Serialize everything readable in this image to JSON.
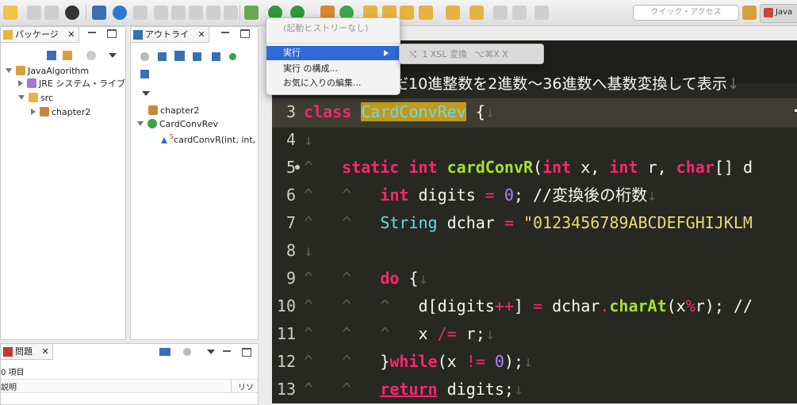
{
  "toolbar": {
    "quick_access_placeholder": "クイック・アクセス",
    "perspective_label": "Java"
  },
  "package_view": {
    "tab_label": "パッケージ",
    "tree": [
      {
        "label": "JavaAlgorithm",
        "expanded": true
      },
      {
        "label": "JRE システム・ライブ",
        "expanded": false
      },
      {
        "label": "src",
        "expanded": true
      },
      {
        "label": "chapter2",
        "expanded": false
      }
    ]
  },
  "outline_view": {
    "tab_label": "アウトライ",
    "tree": [
      {
        "label": "chapter2"
      },
      {
        "label": "CardConvRev"
      },
      {
        "label": "cardConvR(int, int,",
        "modifier": "S"
      }
    ]
  },
  "problems_view": {
    "tab_label": "問題",
    "count_label": "0 項目",
    "columns": [
      "説明",
      "リソ"
    ]
  },
  "run_menu": {
    "items": [
      {
        "label": "(起動ヒストリーなし)",
        "state": "disabled"
      },
      {
        "label": "実行",
        "state": "selected",
        "submenu": true
      },
      {
        "label": "実行 の構成...",
        "state": "normal"
      },
      {
        "label": "お気に入りの編集...",
        "state": "normal"
      }
    ]
  },
  "run_submenu": {
    "items": [
      {
        "label": "1 XSL 変換",
        "shortcut": "⌥⌘X X"
      }
    ]
  },
  "editor": {
    "comment_line_text": "だ10進整数を2進数〜36進数へ基数変換して表示",
    "comment_line_ws": "↓",
    "lines": [
      {
        "n": "3",
        "tokens": [
          [
            "kw",
            "class"
          ],
          [
            "var",
            " "
          ],
          [
            "cls",
            "CardConvRev"
          ],
          [
            "var",
            " {"
          ],
          [
            "ws",
            "↓"
          ]
        ]
      },
      {
        "n": "4",
        "tokens": [
          [
            "ws",
            "↓"
          ]
        ]
      },
      {
        "n": "5",
        "tokens": [
          [
            "ws",
            "^   "
          ],
          [
            "kw",
            "static"
          ],
          [
            "var",
            " "
          ],
          [
            "kw",
            "int"
          ],
          [
            "var",
            " "
          ],
          [
            "fn",
            "cardConvR"
          ],
          [
            "var",
            "("
          ],
          [
            "kw",
            "int"
          ],
          [
            "var",
            " x, "
          ],
          [
            "kw",
            "int"
          ],
          [
            "var",
            " r, "
          ],
          [
            "kw",
            "char"
          ],
          [
            "var",
            "[] d"
          ]
        ]
      },
      {
        "n": "6",
        "tokens": [
          [
            "ws",
            "^   ^   "
          ],
          [
            "kw",
            "int"
          ],
          [
            "var",
            " digits "
          ],
          [
            "op",
            "="
          ],
          [
            "var",
            " "
          ],
          [
            "num",
            "0"
          ],
          [
            "var",
            "; //変換後の桁数"
          ],
          [
            "ws",
            "↓"
          ]
        ]
      },
      {
        "n": "7",
        "tokens": [
          [
            "ws",
            "^   ^   "
          ],
          [
            "ty",
            "String"
          ],
          [
            "var",
            " dchar "
          ],
          [
            "op",
            "="
          ],
          [
            "var",
            " "
          ],
          [
            "str",
            "\"0123456789ABCDEFGHIJKLM"
          ]
        ]
      },
      {
        "n": "8",
        "tokens": [
          [
            "ws",
            "↓"
          ]
        ]
      },
      {
        "n": "9",
        "tokens": [
          [
            "ws",
            "^   ^   "
          ],
          [
            "kw",
            "do"
          ],
          [
            "var",
            " {"
          ],
          [
            "ws",
            "↓"
          ]
        ]
      },
      {
        "n": "10",
        "tokens": [
          [
            "ws",
            "^   ^   ^   "
          ],
          [
            "var",
            "d[digits"
          ],
          [
            "op",
            "++"
          ],
          [
            "var",
            "] "
          ],
          [
            "op",
            "="
          ],
          [
            "var",
            " dchar"
          ],
          [
            "op",
            "."
          ],
          [
            "fn",
            "charAt"
          ],
          [
            "var",
            "(x"
          ],
          [
            "op",
            "%"
          ],
          [
            "var",
            "r); //"
          ]
        ]
      },
      {
        "n": "11",
        "tokens": [
          [
            "ws",
            "^   ^   ^   "
          ],
          [
            "var",
            "x "
          ],
          [
            "op",
            "/="
          ],
          [
            "var",
            " r;"
          ],
          [
            "ws",
            "↓"
          ]
        ]
      },
      {
        "n": "12",
        "tokens": [
          [
            "ws",
            "^   ^   "
          ],
          [
            "var",
            "}"
          ],
          [
            "kw",
            "while"
          ],
          [
            "var",
            "(x "
          ],
          [
            "op",
            "!="
          ],
          [
            "var",
            " "
          ],
          [
            "num",
            "0"
          ],
          [
            "var",
            ");"
          ],
          [
            "ws",
            "↓"
          ]
        ]
      },
      {
        "n": "13",
        "tokens": [
          [
            "ws",
            "^   ^   "
          ],
          [
            "kwu",
            "return"
          ],
          [
            "var",
            " digits;"
          ],
          [
            "ws",
            "↓"
          ]
        ]
      }
    ]
  },
  "colors": {
    "editor_bg": "#272822",
    "keyword": "#f92672",
    "type": "#66d9ef",
    "function": "#a6e22e",
    "number": "#ae81ff",
    "string": "#e6db74",
    "highlight": "#c49a1c",
    "menu_selected": "#2f6ad8"
  }
}
